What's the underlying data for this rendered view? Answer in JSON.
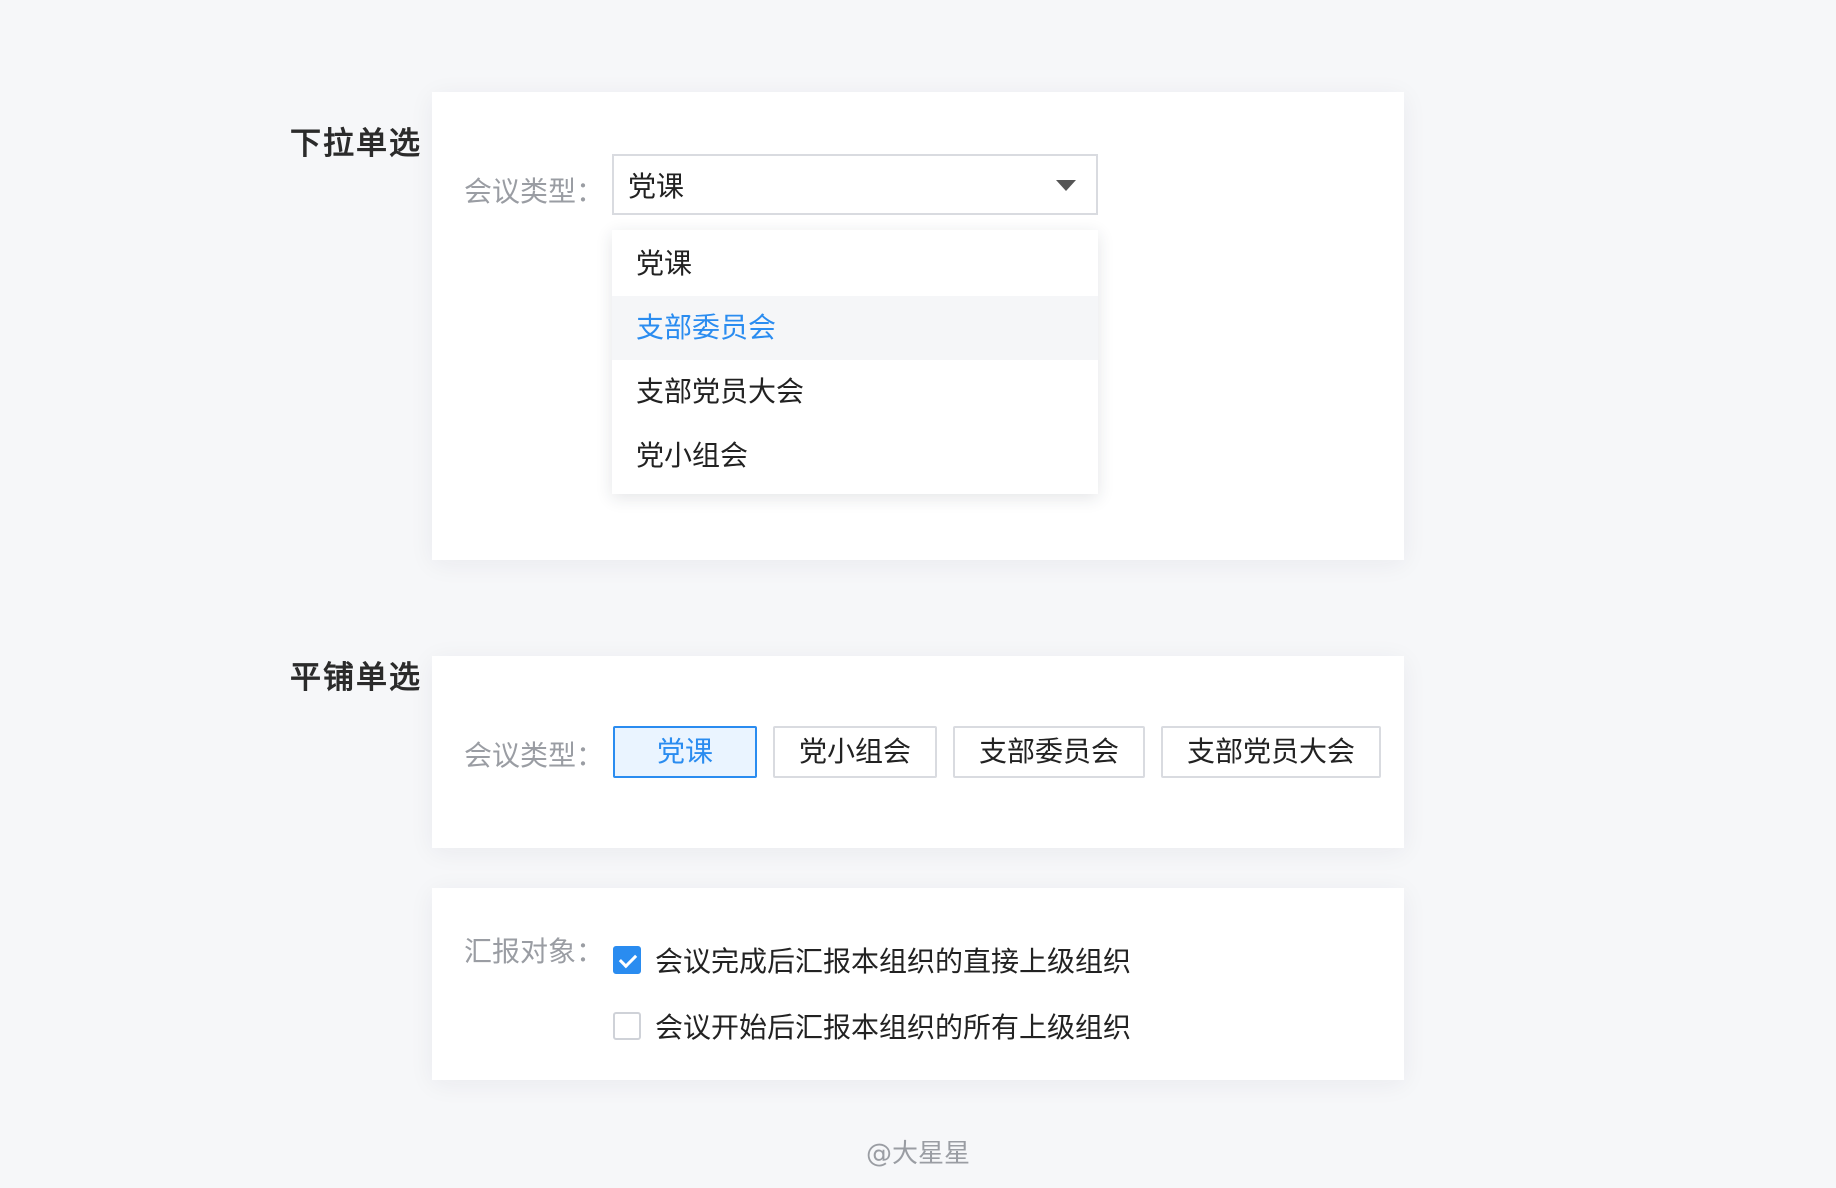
{
  "dropdown_section": {
    "title": "下拉单选",
    "field_label": "会议类型：",
    "selected_value": "党课",
    "options": [
      {
        "label": "党课"
      },
      {
        "label": "支部委员会"
      },
      {
        "label": "支部党员大会"
      },
      {
        "label": "党小组会"
      }
    ]
  },
  "tile_section": {
    "title": "平铺单选",
    "field_label": "会议类型：",
    "options": [
      {
        "label": "党课",
        "selected": true
      },
      {
        "label": "党小组会",
        "selected": false
      },
      {
        "label": "支部委员会",
        "selected": false
      },
      {
        "label": "支部党员大会",
        "selected": false
      }
    ]
  },
  "report_section": {
    "field_label": "汇报对象：",
    "options": [
      {
        "label": "会议完成后汇报本组织的直接上级组织",
        "checked": true
      },
      {
        "label": "会议开始后汇报本组织的所有上级组织",
        "checked": false
      }
    ]
  },
  "watermark": "@大星星",
  "colors": {
    "accent": "#2a8cf0",
    "background": "#f6f7f9",
    "label_gray": "#9a9da3"
  },
  "icons": {
    "select_arrow": "caret-down-icon",
    "checkbox_check": "checkmark-icon"
  }
}
